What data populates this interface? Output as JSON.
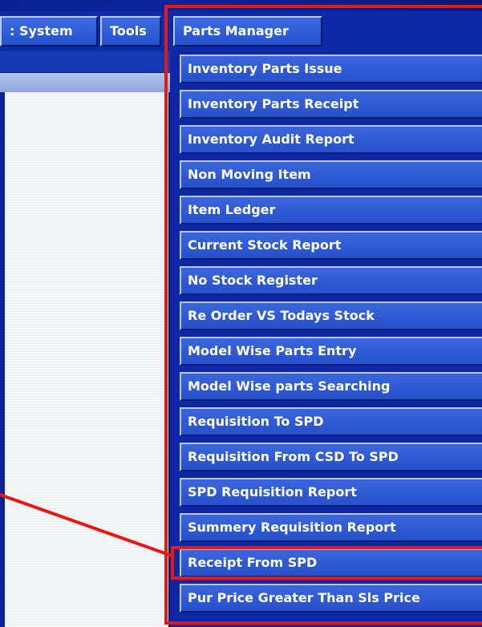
{
  "menubar": {
    "items": [
      {
        "label": ": System"
      },
      {
        "label": "Tools"
      },
      {
        "label": "Parts Manager"
      }
    ]
  },
  "dropdown": {
    "items": [
      {
        "label": "Inventory Parts Issue"
      },
      {
        "label": "Inventory Parts Receipt"
      },
      {
        "label": "Inventory Audit Report"
      },
      {
        "label": "Non Moving Item"
      },
      {
        "label": "Item Ledger"
      },
      {
        "label": "Current Stock Report"
      },
      {
        "label": "No Stock Register"
      },
      {
        "label": "Re Order VS Todays Stock"
      },
      {
        "label": "Model Wise Parts Entry"
      },
      {
        "label": "Model Wise parts Searching"
      },
      {
        "label": "Requisition To SPD"
      },
      {
        "label": "Requisition From CSD To SPD"
      },
      {
        "label": "SPD Requisition Report"
      },
      {
        "label": "Summery Requisition Report"
      },
      {
        "label": "Receipt From SPD"
      },
      {
        "label": "Pur Price Greater Than Sls Price"
      }
    ],
    "highlighted_item": "Receipt From SPD"
  },
  "colors": {
    "highlight": "#e8170f",
    "menu_blue": "#2a58d4",
    "background_blue": "#0b2399"
  }
}
